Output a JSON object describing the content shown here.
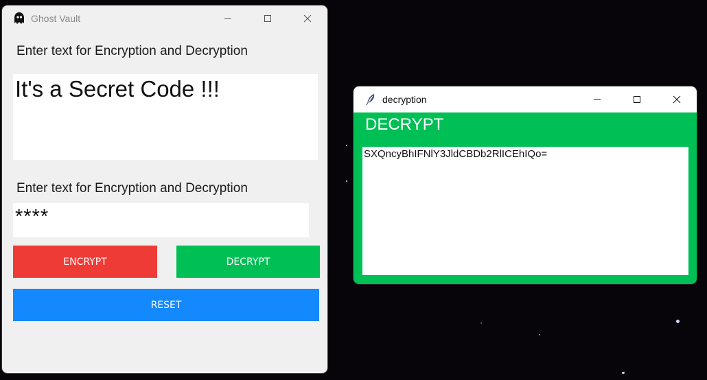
{
  "main_window": {
    "title": "Ghost Vault",
    "icon": "ghost-icon",
    "label_message": "Enter text for Encryption and Decryption",
    "message_value": "It's a Secret Code !!!",
    "label_key": "Enter text for Encryption and Decryption",
    "key_value": "****",
    "buttons": {
      "encrypt": "ENCRYPT",
      "decrypt": "DECRYPT",
      "reset": "RESET"
    },
    "colors": {
      "encrypt": "#ef3b36",
      "decrypt": "#00bf55",
      "reset": "#1389fd",
      "background": "#f0f0f0"
    }
  },
  "decryption_window": {
    "title": "decryption",
    "icon": "feather-icon",
    "heading": "DECRYPT",
    "output_value": "SXQncyBhIFNlY3JldCBDb2RlICEhIQo=",
    "colors": {
      "background": "#00bf55"
    }
  },
  "window_controls": {
    "minimize": "minimize-icon",
    "maximize": "maximize-icon",
    "close": "close-icon"
  }
}
